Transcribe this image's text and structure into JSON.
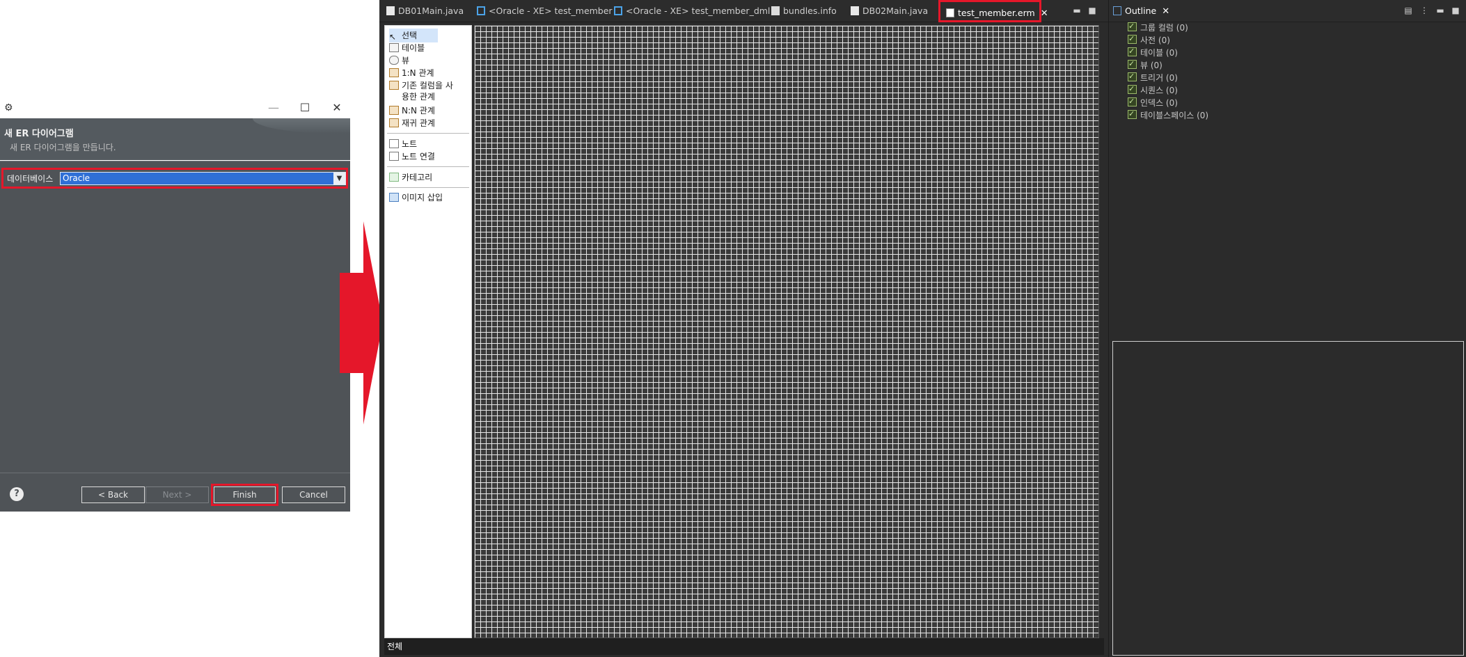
{
  "dialog": {
    "title": "",
    "banner_title": "새 ER 다이어그램",
    "banner_subtitle": "새 ER 다이어그램을 만듭니다.",
    "database_label": "데이터베이스",
    "database_value": "Oracle",
    "back_label": "< Back",
    "next_label": "Next >",
    "finish_label": "Finish",
    "cancel_label": "Cancel",
    "help_symbol": "?",
    "minimize_symbol": "—",
    "maximize_symbol": "☐",
    "close_symbol": "✕"
  },
  "editor": {
    "tabs": [
      {
        "label": "DB01Main.java",
        "icon": "java-file-icon"
      },
      {
        "label": "<Oracle - XE> test_member",
        "icon": "sql-file-icon"
      },
      {
        "label": "<Oracle - XE> test_member_dml",
        "icon": "sql-file-icon"
      },
      {
        "label": "bundles.info",
        "icon": "text-file-icon"
      },
      {
        "label": "DB02Main.java",
        "icon": "java-file-icon"
      },
      {
        "label": "test_member.erm",
        "icon": "erm-file-icon",
        "active": true
      }
    ],
    "palette": [
      "선택",
      "테이블",
      "뷰",
      "1:N 관계",
      "기존 컬럼을 사",
      "용한 관계",
      "N:N 관계",
      "재귀 관계",
      "노트",
      "노트 연결",
      "카테고리",
      "이미지 삽입"
    ],
    "status_text": "전체"
  },
  "outline": {
    "title": "Outline",
    "items": [
      "그룹 컬럼 (0)",
      "사전 (0)",
      "테이블 (0)",
      "뷰 (0)",
      "트리거 (0)",
      "시퀀스 (0)",
      "인덱스 (0)",
      "테이블스페이스 (0)"
    ]
  },
  "colors": {
    "highlight": "#e5172a",
    "selection": "#2f6fd6",
    "ide_background": "#2b2b2b"
  }
}
